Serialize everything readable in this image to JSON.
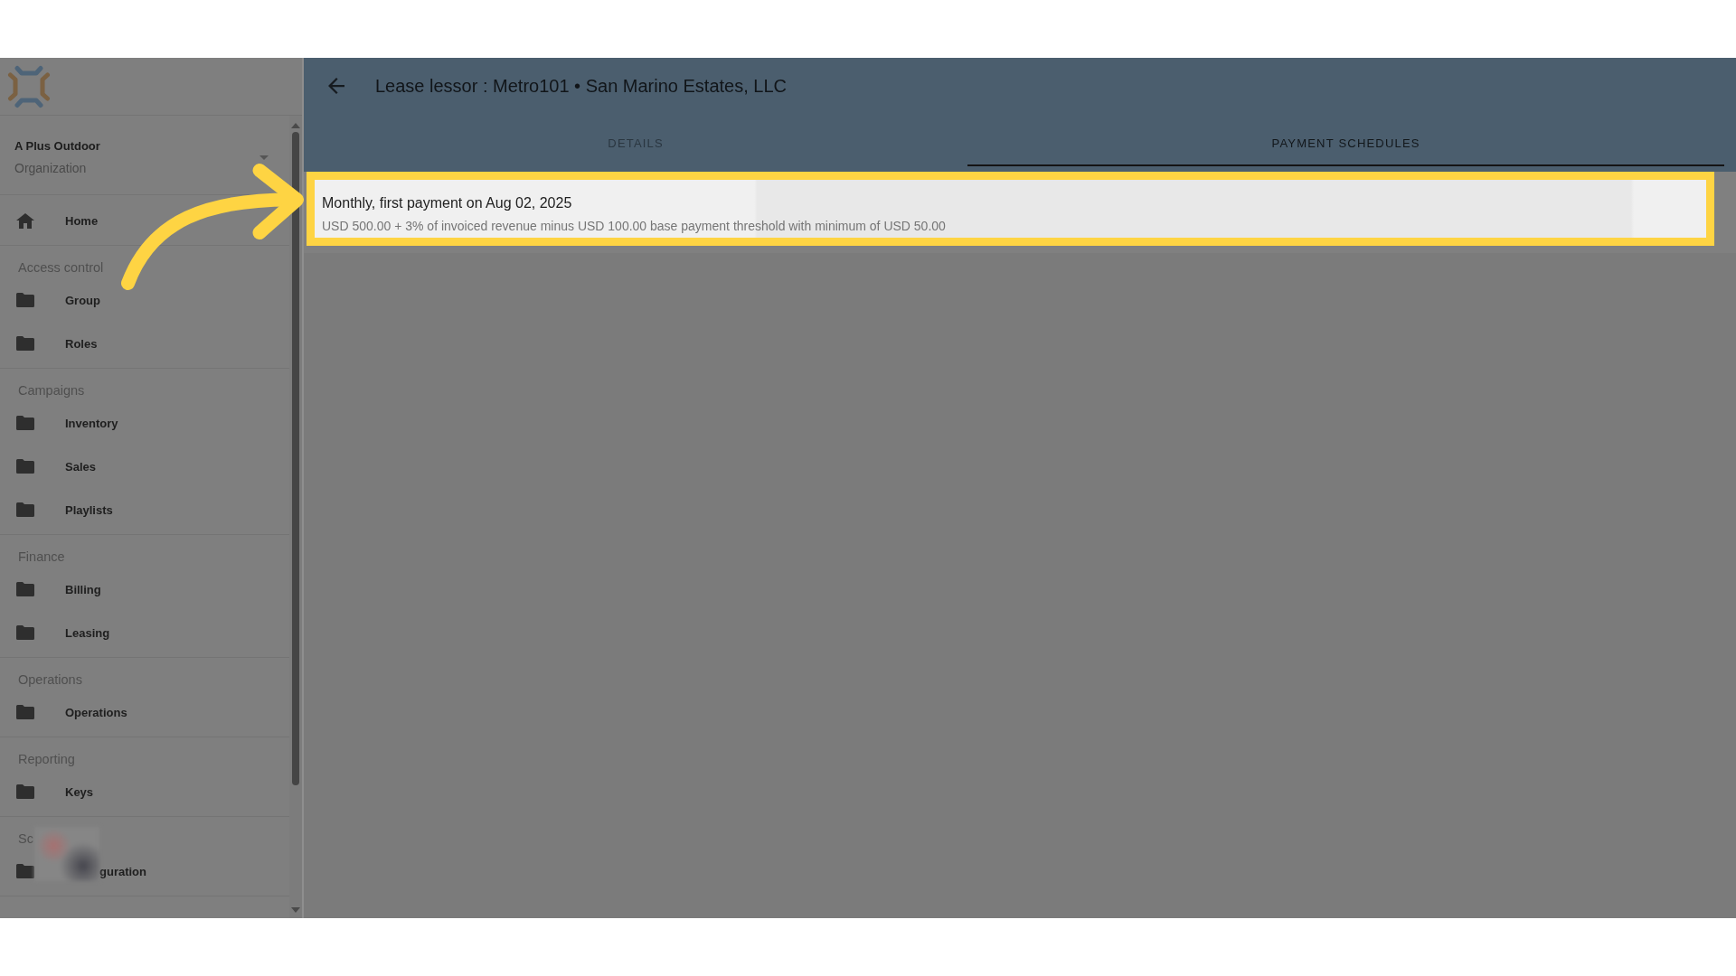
{
  "organization": {
    "name": "A Plus Outdoor",
    "role": "Organization"
  },
  "sidebar": {
    "home": {
      "label": "Home"
    },
    "sections": [
      {
        "title": "Access control",
        "obscured": false,
        "items": [
          {
            "label": "Group"
          },
          {
            "label": "Roles"
          }
        ]
      },
      {
        "title": "Campaigns",
        "obscured": false,
        "items": [
          {
            "label": "Inventory"
          },
          {
            "label": "Sales"
          },
          {
            "label": "Playlists"
          }
        ]
      },
      {
        "title": "Finance",
        "obscured": false,
        "items": [
          {
            "label": "Billing"
          },
          {
            "label": "Leasing"
          }
        ]
      },
      {
        "title": "Operations",
        "obscured": false,
        "items": [
          {
            "label": "Operations"
          }
        ]
      },
      {
        "title": "Reporting",
        "obscured": false,
        "items": [
          {
            "label": "Keys"
          }
        ]
      },
      {
        "title": "Sc",
        "obscured": true,
        "items": [
          {
            "label": "guration"
          }
        ]
      }
    ]
  },
  "header": {
    "title": "Lease lessor : Metro101 • San Marino Estates, LLC",
    "tabs": [
      {
        "label": "DETAILS",
        "selected": false
      },
      {
        "label": "PAYMENT SCHEDULES",
        "selected": true
      }
    ]
  },
  "payment_schedules": [
    {
      "title": "Monthly, first payment on Aug 02, 2025",
      "description": "USD 500.00 + 3% of invoiced revenue minus USD 100.00 base payment threshold with minimum of USD 50.00",
      "highlighted": true
    }
  ]
}
